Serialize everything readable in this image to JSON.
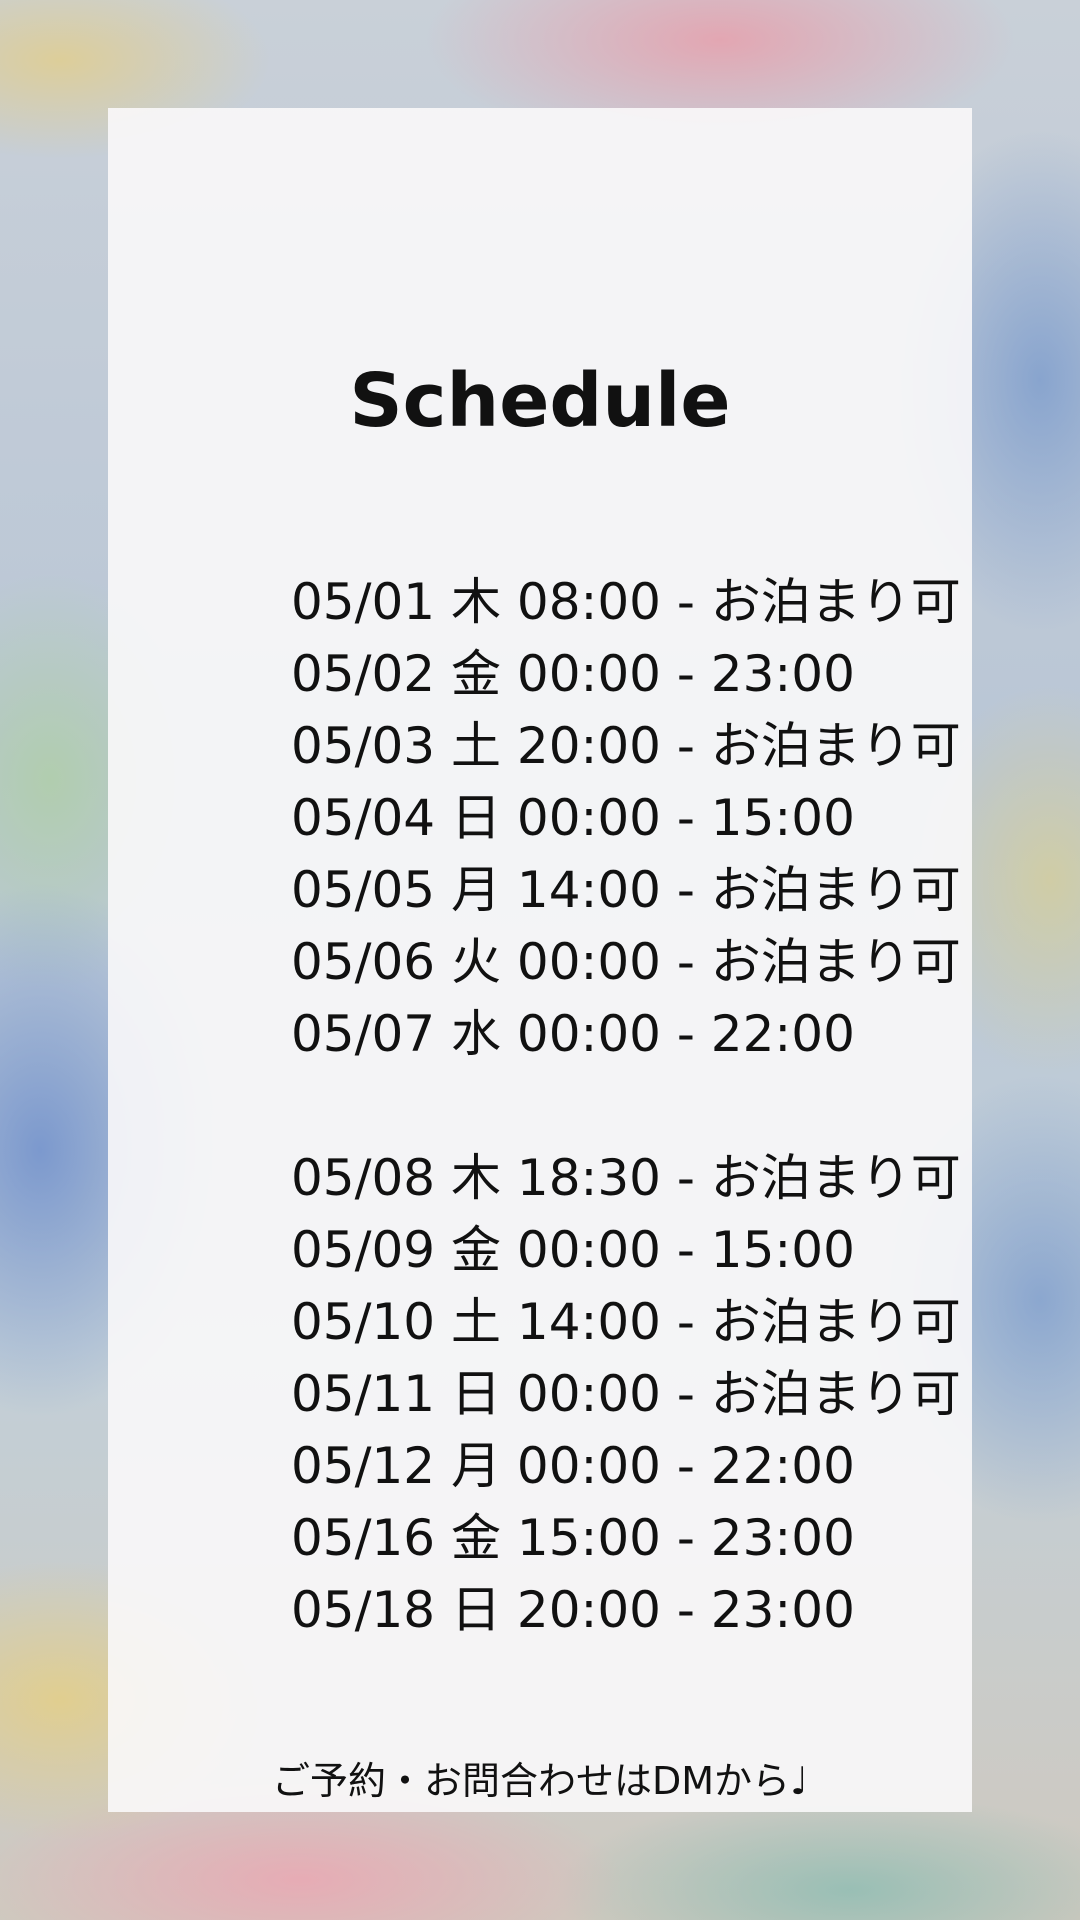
{
  "title": "Schedule",
  "schedule_group_1": [
    "05/01 木 08:00 - お泊まり可",
    "05/02 金 00:00 - 23:00",
    "05/03 土 20:00 - お泊まり可",
    "05/04 日 00:00 - 15:00",
    "05/05 月 14:00 - お泊まり可",
    "05/06 火 00:00 - お泊まり可",
    "05/07 水 00:00 - 22:00"
  ],
  "schedule_group_2": [
    "05/08 木 18:30 - お泊まり可",
    "05/09 金 00:00 - 15:00",
    "05/10 土 14:00 - お泊まり可",
    "05/11 日 00:00 - お泊まり可",
    "05/12 月 00:00 - 22:00",
    "05/16 金 15:00 - 23:00",
    "05/18 日 20:00 - 23:00"
  ],
  "footer": "ご予約・お問合わせはDMから♩"
}
